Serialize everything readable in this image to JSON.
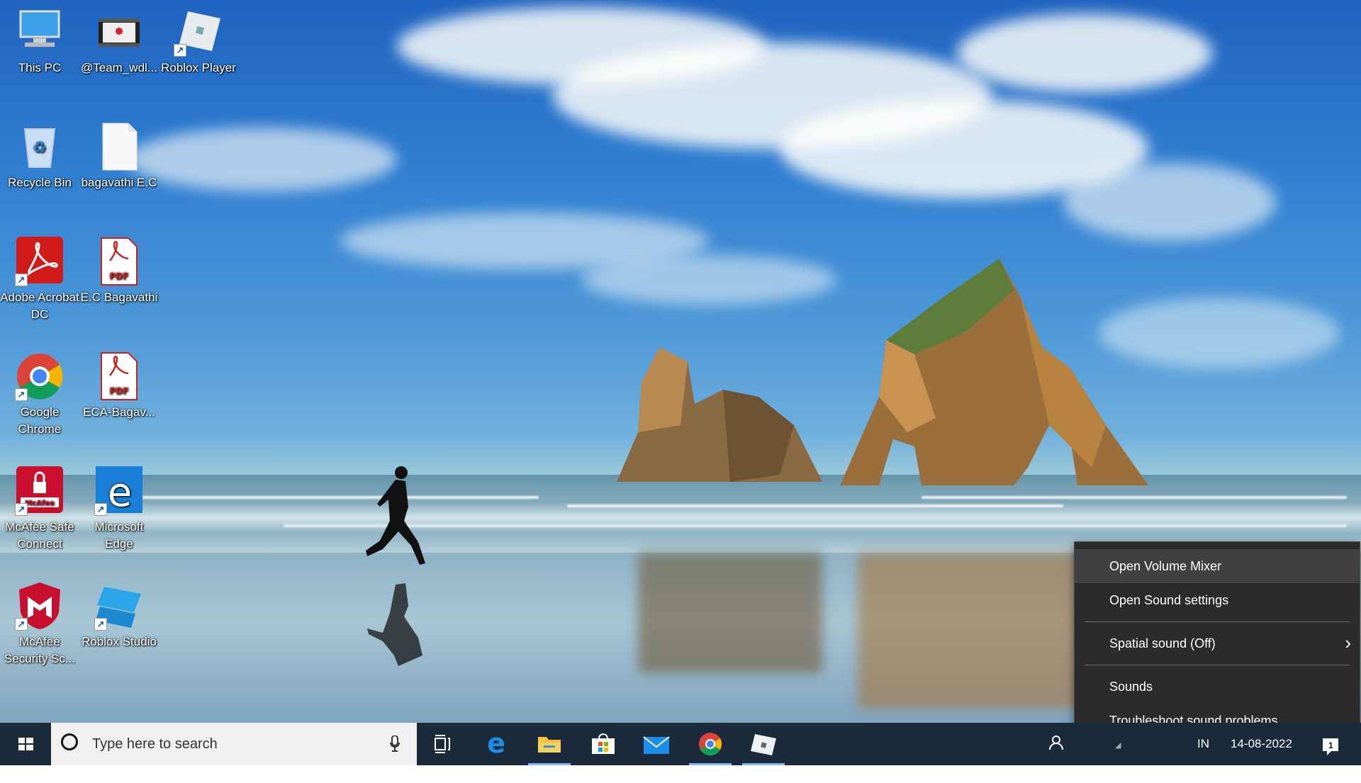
{
  "desktop_icons": [
    {
      "label": "This PC",
      "icon": "this-pc-icon"
    },
    {
      "label": "@Team_wdl...",
      "icon": "video-file-icon"
    },
    {
      "label": "Roblox Player",
      "icon": "roblox-player-icon"
    },
    {
      "label": "Recycle Bin",
      "icon": "recycle-bin-icon"
    },
    {
      "label": "bagavathi E.C",
      "icon": "blank-file-icon"
    },
    {
      "label": "Adobe Acrobat DC",
      "icon": "adobe-acrobat-icon"
    },
    {
      "label": "E.C Bagavathi",
      "icon": "pdf-file-icon"
    },
    {
      "label": "Google Chrome",
      "icon": "chrome-icon"
    },
    {
      "label": "ECA-Bagav...",
      "icon": "pdf-file-icon"
    },
    {
      "label": "McAfee Safe Connect",
      "icon": "mcafee-safe-connect-icon"
    },
    {
      "label": "Microsoft Edge",
      "icon": "edge-icon"
    },
    {
      "label": "McAfee Security Sc...",
      "icon": "mcafee-security-icon"
    },
    {
      "label": "Roblox Studio",
      "icon": "roblox-studio-icon"
    }
  ],
  "context_menu": {
    "items": [
      {
        "label": "Open Volume Mixer"
      },
      {
        "label": "Open Sound settings"
      },
      {
        "label": "Spatial sound (Off)"
      },
      {
        "label": "Sounds"
      },
      {
        "label": "Troubleshoot sound problems"
      }
    ]
  },
  "taskbar": {
    "search_placeholder": "Type here to search",
    "apps": [
      "task-view-icon",
      "edge-icon",
      "file-explorer-icon",
      "microsoft-store-icon",
      "mail-icon",
      "chrome-icon",
      "roblox-icon"
    ],
    "tray": {
      "language": "IN",
      "date": "14-08-2022",
      "notification_count": "1"
    }
  },
  "colors": {
    "menu_bg": "#2b2b2b",
    "menu_highlight": "#414141",
    "taskbar_bg": "#1b2a3a",
    "active_indicator": "#8ab4f8"
  }
}
